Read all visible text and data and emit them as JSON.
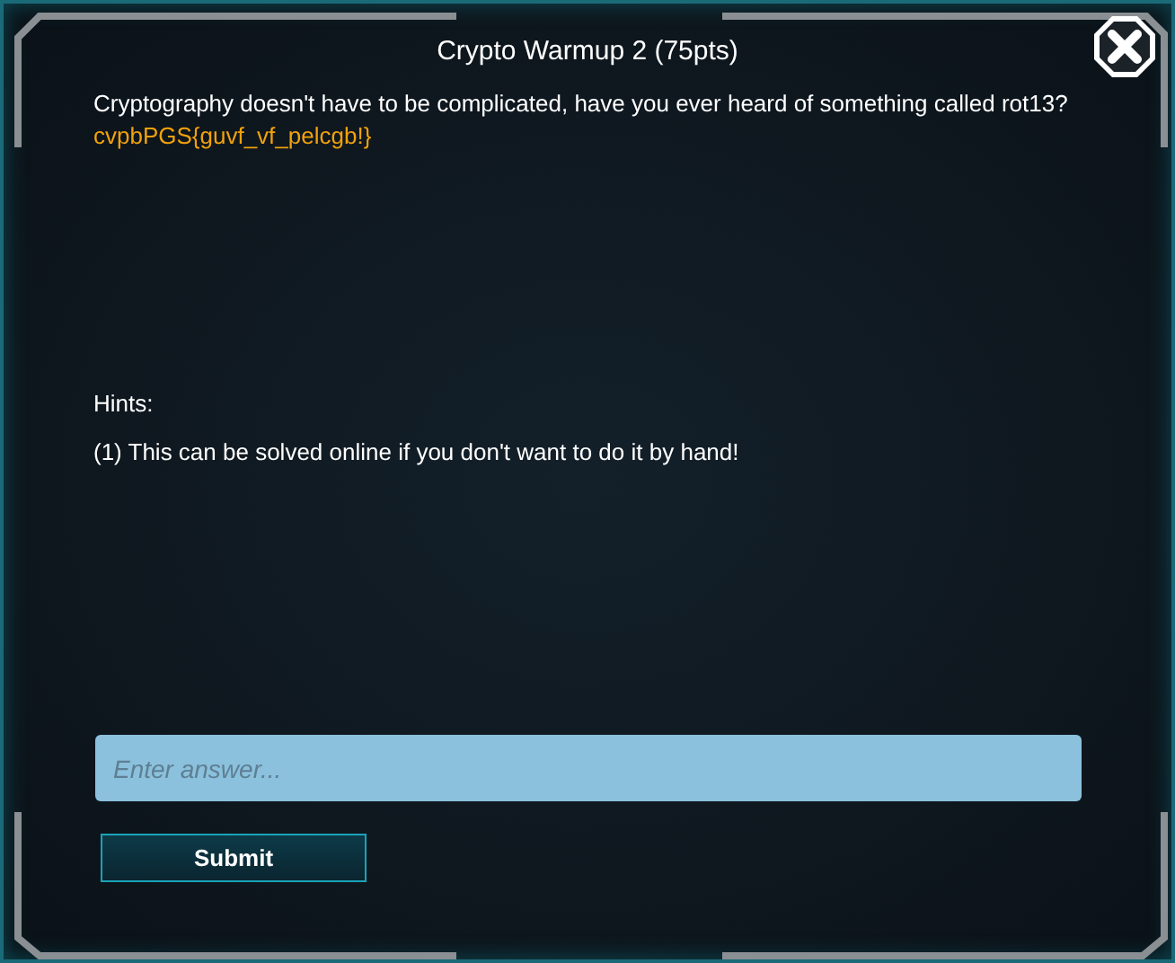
{
  "dialog": {
    "title": "Crypto Warmup 2 (75pts)",
    "description": "Cryptography doesn't have to be complicated, have you ever heard of something called rot13? ",
    "flag_text": "cvpbPGS{guvf_vf_pelcgb!}",
    "hints_label": "Hints:",
    "hints": [
      "(1) This can be solved online if you don't want to do it by hand!"
    ],
    "answer": {
      "placeholder": "Enter answer..."
    },
    "submit_button": "Submit"
  }
}
